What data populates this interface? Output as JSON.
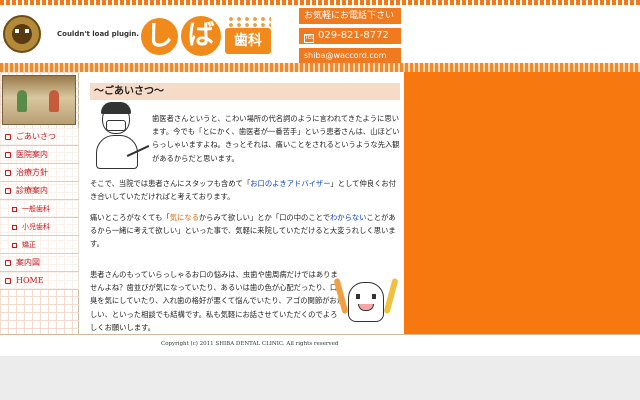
{
  "header": {
    "plugin_message": "Couldn't load plugin.",
    "logo_kana_1": "し",
    "logo_kana_2": "ば",
    "logo_sub": "歯科",
    "contact_call": "お気軽にお電話下さい",
    "tel_icon_text": "TEL",
    "tel": "029-821-8772",
    "email": "shiba@waccord.com"
  },
  "sidebar": {
    "items": [
      {
        "label": "ごあいさつ",
        "sub": false,
        "highlight": false
      },
      {
        "label": "医院案内",
        "sub": false,
        "highlight": false
      },
      {
        "label": "治療方針",
        "sub": false,
        "highlight": false
      },
      {
        "label": "診療案内",
        "sub": false,
        "highlight": false
      },
      {
        "label": "一般歯科",
        "sub": true,
        "highlight": false
      },
      {
        "label": "小児歯科",
        "sub": true,
        "highlight": false
      },
      {
        "label": "矯正",
        "sub": true,
        "highlight": false
      },
      {
        "label": "案内図",
        "sub": false,
        "highlight": false
      },
      {
        "label": "HOME",
        "sub": false,
        "highlight": false
      }
    ]
  },
  "content": {
    "title": "～ごあいさつ～",
    "p1": "歯医者さんというと、こわい場所の代名詞のように言われてきたように思います。今でも「とにかく、歯医者が一番苦手」という患者さんは、山ほどいらっしゃいますよね。きっとそれは、痛いことをされるというような先入観があるからだと思います。",
    "p2_a": "そこで、当院では患者さんにスタッフも含めて「",
    "p2_hl": "お口のよきアドバイザー",
    "p2_b": "」として仲良くお付き合いしていただければと考えております。",
    "p3_a": "痛いところがなくても「",
    "p3_hl1": "気になる",
    "p3_b": "からみて欲しい」とか「口の中のことで",
    "p3_hl2": "わからない",
    "p3_c": "ことがあるから一緒に考えて欲しい」といった事で、気軽に来院していただけると大変うれしく思います。",
    "p4": "患者さんのもっていらっしゃるお口の悩みは、虫歯や歯周病だけではありませんよね？歯並びが気になっていたり、あるいは歯の色が心配だったり、口臭を気にしていたり、入れ歯の格好が悪くて悩んでいたり、アゴの関節がおかしい、といった相談でも結構です。私も気軽にお話させていただくのでよろしくお願いします。"
  },
  "footer": {
    "copyright": "Copyright (c) 2011 SHIBA DENTAL CLINIC. All rights reserved"
  },
  "colors": {
    "accent": "#f7780f",
    "nav_text": "#c8161d",
    "highlight_blue": "#0a40c8",
    "highlight_orange": "#e0660a"
  }
}
